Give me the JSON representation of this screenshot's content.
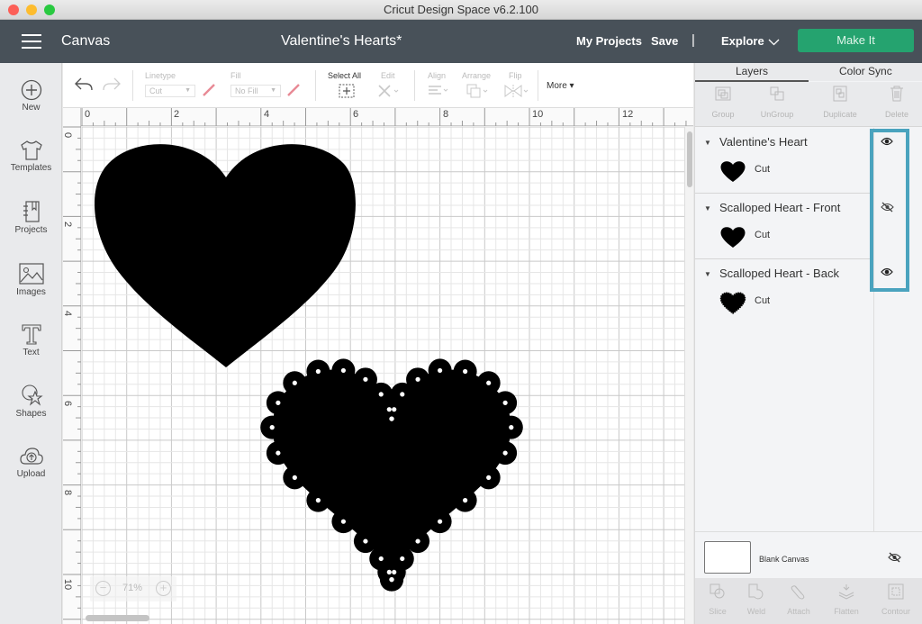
{
  "window": {
    "title": "Cricut Design Space  v6.2.100"
  },
  "header": {
    "section": "Canvas",
    "project_title": "Valentine's Hearts*",
    "my_projects": "My Projects",
    "save": "Save",
    "separator": "|",
    "explore": "Explore",
    "make_it": "Make It",
    "make_it_color": "#25a36f"
  },
  "sidebar": {
    "items": [
      {
        "label": "New",
        "icon": "plus-circle-icon"
      },
      {
        "label": "Templates",
        "icon": "tshirt-icon"
      },
      {
        "label": "Projects",
        "icon": "notebook-icon"
      },
      {
        "label": "Images",
        "icon": "image-icon"
      },
      {
        "label": "Text",
        "icon": "text-icon"
      },
      {
        "label": "Shapes",
        "icon": "shapes-icon"
      },
      {
        "label": "Upload",
        "icon": "cloud-upload-icon"
      }
    ]
  },
  "toolbar": {
    "linetype_label": "Linetype",
    "linetype_value": "Cut",
    "fill_label": "Fill",
    "fill_value": "No Fill",
    "select_all": "Select All",
    "edit": "Edit",
    "align": "Align",
    "arrange": "Arrange",
    "flip": "Flip",
    "more": "More ▾"
  },
  "rulers": {
    "top": [
      "0",
      "2",
      "4",
      "6",
      "8",
      "10",
      "12"
    ],
    "left": [
      "0",
      "2",
      "4",
      "6",
      "8",
      "10"
    ]
  },
  "zoom": {
    "level": "71%",
    "minus": "−",
    "plus": "+"
  },
  "panel": {
    "tabs": [
      "Layers",
      "Color Sync"
    ],
    "active_tab": "Layers",
    "tools": [
      "Group",
      "UnGroup",
      "Duplicate",
      "Delete"
    ],
    "layers": [
      {
        "name": "Valentine's Heart",
        "operation": "Cut",
        "visible": true
      },
      {
        "name": "Scalloped Heart - Front",
        "operation": "Cut",
        "visible": false
      },
      {
        "name": "Scalloped Heart - Back",
        "operation": "Cut",
        "visible": true
      }
    ],
    "highlight_color": "#4aa3be",
    "blank_canvas": "Blank Canvas",
    "bottom_tools": [
      "Slice",
      "Weld",
      "Attach",
      "Flatten",
      "Contour"
    ]
  }
}
